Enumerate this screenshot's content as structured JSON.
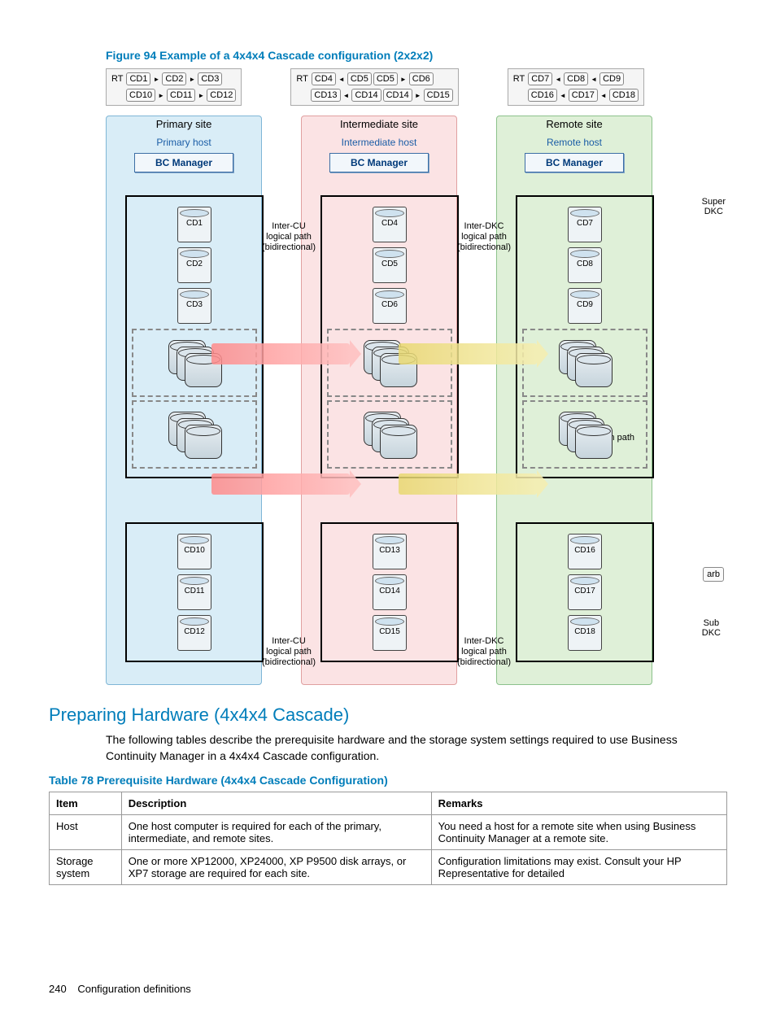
{
  "figure": {
    "caption": "Figure 94 Example of a 4x4x4 Cascade configuration (2x2x2)",
    "rt_label": "RT",
    "top_groups": [
      {
        "row1": [
          "CD1",
          "CD2",
          "CD3"
        ],
        "row1_dirs": [
          "r",
          "r"
        ],
        "row2": [
          "CD10",
          "CD11",
          "CD12"
        ],
        "row2_dirs": [
          "r",
          "r"
        ]
      },
      {
        "row1": [
          "CD4",
          "CD5",
          "CD5",
          "CD6"
        ],
        "row1_dirs": [
          "l",
          "",
          "r"
        ],
        "row2": [
          "CD13",
          "CD14",
          "CD14",
          "CD15"
        ],
        "row2_dirs": [
          "l",
          "",
          "r"
        ]
      },
      {
        "row1": [
          "CD7",
          "CD8",
          "CD9"
        ],
        "row1_dirs": [
          "l",
          "l"
        ],
        "row2": [
          "CD16",
          "CD17",
          "CD18"
        ],
        "row2_dirs": [
          "l",
          "l"
        ]
      }
    ],
    "sites": {
      "primary": {
        "site": "Primary site",
        "host": "Primary host",
        "bc": "BC Manager"
      },
      "inter": {
        "site": "Intermediate site",
        "host": "Intermediate host",
        "bc": "BC Manager"
      },
      "remote": {
        "site": "Remote site",
        "host": "Remote host",
        "bc": "BC Manager"
      }
    },
    "cds_top": [
      [
        "CD1",
        "CD4",
        "CD7"
      ],
      [
        "CD2",
        "CD5",
        "CD8"
      ],
      [
        "CD3",
        "CD6",
        "CD9"
      ]
    ],
    "cds_bottom": [
      [
        "CD10",
        "CD13",
        "CD16"
      ],
      [
        "CD11",
        "CD14",
        "CD17"
      ],
      [
        "CD12",
        "CD15",
        "CD18"
      ]
    ],
    "labels": {
      "inter_cu": "Inter-CU\nlogical path\n(bidirectional)",
      "inter_dkc": "Inter-DKC\nlogical path\n(bidirectional)",
      "arbitration": "Arbitration path",
      "super_dkc": "Super\nDKC",
      "sub_dkc": "Sub\nDKC",
      "arb": "arb"
    }
  },
  "section": {
    "heading": "Preparing Hardware (4x4x4 Cascade)",
    "body": "The following tables describe the prerequisite hardware and the storage system settings required to use Business Continuity Manager in a 4x4x4 Cascade configuration."
  },
  "table": {
    "caption": "Table 78  Prerequisite Hardware (4x4x4 Cascade Configuration)",
    "headers": [
      "Item",
      "Description",
      "Remarks"
    ],
    "rows": [
      {
        "item": "Host",
        "desc": "One host computer is required for each of the primary, intermediate, and remote sites.",
        "rem": "You need a host for a remote site when using Business Continuity Manager at a remote site."
      },
      {
        "item": "Storage system",
        "desc": "One or more XP12000, XP24000, XP P9500 disk arrays, or XP7 storage are required for each site.",
        "rem": "Configuration limitations may exist. Consult your HP Representative for detailed"
      }
    ]
  },
  "footer": {
    "page": "240",
    "title": "Configuration definitions"
  }
}
